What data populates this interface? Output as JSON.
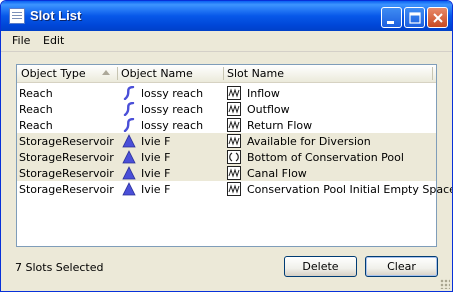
{
  "window": {
    "title": "Slot List"
  },
  "menu": {
    "items": [
      "File",
      "Edit"
    ]
  },
  "table": {
    "columns": [
      "Object Type",
      "Object Name",
      "Slot Name"
    ],
    "rows": [
      {
        "object_type": "Reach",
        "object_icon": "reach-icon",
        "object_name": "lossy reach",
        "slot_icon": "series-slot-icon",
        "slot_name": "Inflow",
        "selected": false
      },
      {
        "object_type": "Reach",
        "object_icon": "reach-icon",
        "object_name": "lossy reach",
        "slot_icon": "series-slot-icon",
        "slot_name": "Outflow",
        "selected": false
      },
      {
        "object_type": "Reach",
        "object_icon": "reach-icon",
        "object_name": "lossy reach",
        "slot_icon": "series-slot-icon",
        "slot_name": "Return Flow",
        "selected": false
      },
      {
        "object_type": "StorageReservoir",
        "object_icon": "reservoir-icon",
        "object_name": "Ivie F",
        "slot_icon": "series-slot-icon",
        "slot_name": "Available for Diversion",
        "selected": true
      },
      {
        "object_type": "StorageReservoir",
        "object_icon": "reservoir-icon",
        "object_name": "Ivie F",
        "slot_icon": "scalar-slot-icon",
        "slot_name": "Bottom of Conservation Pool",
        "selected": true
      },
      {
        "object_type": "StorageReservoir",
        "object_icon": "reservoir-icon",
        "object_name": "Ivie F",
        "slot_icon": "series-slot-icon",
        "slot_name": "Canal Flow",
        "selected": true
      },
      {
        "object_type": "StorageReservoir",
        "object_icon": "reservoir-icon",
        "object_name": "Ivie F",
        "slot_icon": "series-slot-icon",
        "slot_name": "Conservation Pool Initial Empty Space",
        "selected": false
      }
    ]
  },
  "status": {
    "text": "7 Slots Selected"
  },
  "buttons": {
    "delete": "Delete",
    "clear": "Clear"
  },
  "colors": {
    "titlebar": "#0758e9",
    "selected_row": "#ece9d8",
    "reach_icon": "#4a4fd8",
    "reservoir_icon": "#4a4fd8"
  }
}
